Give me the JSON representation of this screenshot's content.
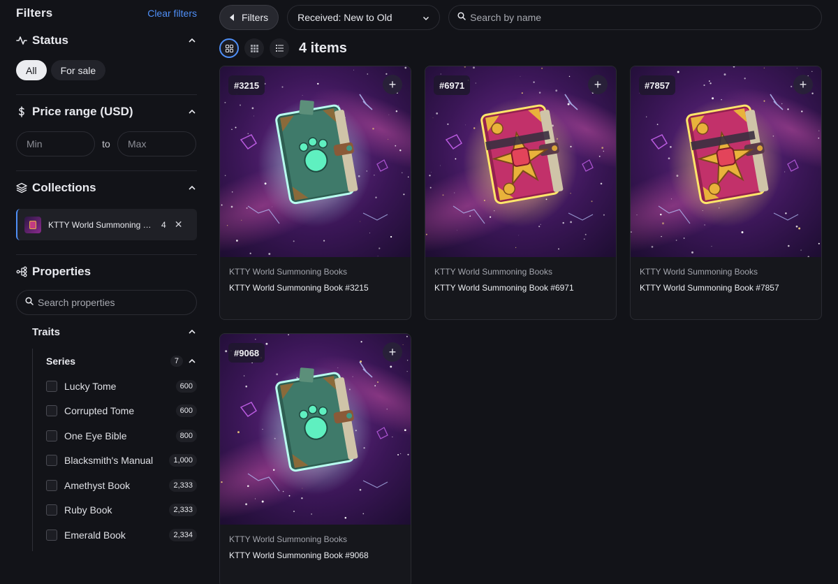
{
  "sidebar": {
    "title": "Filters",
    "clear_label": "Clear filters",
    "status": {
      "label": "Status",
      "options": [
        "All",
        "For sale"
      ],
      "selected": "All"
    },
    "price": {
      "label": "Price range (USD)",
      "min_placeholder": "Min",
      "max_placeholder": "Max",
      "to_label": "to"
    },
    "collections": {
      "label": "Collections",
      "selected": {
        "name": "KTTY World Summoning Books",
        "display_name": "KTTY World Summoning Bo...",
        "count": "4"
      }
    },
    "properties": {
      "label": "Properties",
      "search_placeholder": "Search properties",
      "traits_label": "Traits",
      "series": {
        "label": "Series",
        "count": "7",
        "items": [
          {
            "name": "Lucky Tome",
            "count": "600"
          },
          {
            "name": "Corrupted Tome",
            "count": "600"
          },
          {
            "name": "One Eye Bible",
            "count": "800"
          },
          {
            "name": "Blacksmith's Manual",
            "count": "1,000"
          },
          {
            "name": "Amethyst Book",
            "count": "2,333"
          },
          {
            "name": "Ruby Book",
            "count": "2,333"
          },
          {
            "name": "Emerald Book",
            "count": "2,334"
          }
        ]
      }
    }
  },
  "toolbar": {
    "filters_label": "Filters",
    "sort_value": "Received: New to Old",
    "search_placeholder": "Search by name",
    "items_count": "4 items"
  },
  "cards": [
    {
      "tag": "#3215",
      "collection": "KTTY World Summoning Books",
      "name": "KTTY World Summoning Book #3215",
      "book": "emerald"
    },
    {
      "tag": "#6971",
      "collection": "KTTY World Summoning Books",
      "name": "KTTY World Summoning Book #6971",
      "book": "ruby"
    },
    {
      "tag": "#7857",
      "collection": "KTTY World Summoning Books",
      "name": "KTTY World Summoning Book #7857",
      "book": "ruby"
    },
    {
      "tag": "#9068",
      "collection": "KTTY World Summoning Books",
      "name": "KTTY World Summoning Book #9068",
      "book": "emerald"
    }
  ],
  "colors": {
    "accent": "#4f8ff7",
    "background": "#121318"
  }
}
